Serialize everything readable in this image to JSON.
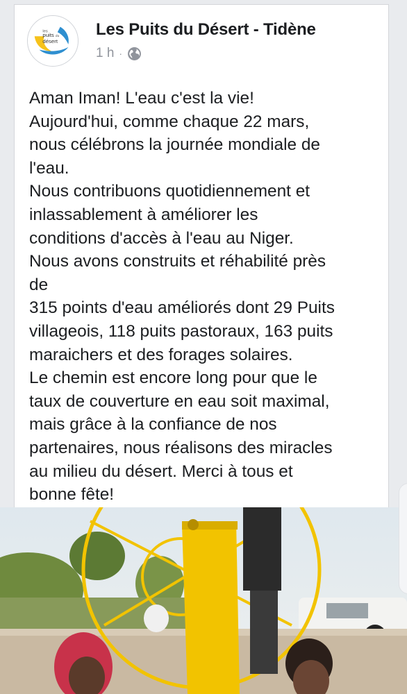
{
  "post": {
    "page_name": "Les Puits du Désert - Tidène",
    "time": "1 h",
    "separator": "·",
    "privacy_icon": "globe-icon",
    "avatar_logo_text": [
      "les",
      "puits",
      "du",
      "désert"
    ],
    "text_lines": [
      "Aman Iman! L'eau c'est la vie!",
      "Aujourd'hui, comme chaque 22 mars,",
      "nous célébrons la journée mondiale de",
      "l'eau.",
      "Nous contribuons quotidiennement et",
      "inlassablement à améliorer les",
      "conditions d'accès à l'eau au Niger.",
      "Nous avons construits et réhabilité près",
      "de",
      "315 points d'eau améliorés dont 29 Puits",
      "villageois, 118 puits pastoraux, 163 puits",
      "maraichers et des forages solaires.",
      "Le chemin est encore long pour que le",
      "taux de couverture en eau soit maximal,",
      "mais grâce à la confiance de nos",
      "partenaires, nous réalisons des miracles",
      "au milieu du désert. Merci à tous et",
      "bonne fête!"
    ]
  },
  "colors": {
    "logo_blue": "#2f8fd0",
    "logo_yellow": "#f6c21b",
    "well_yellow": "#f2c300"
  }
}
